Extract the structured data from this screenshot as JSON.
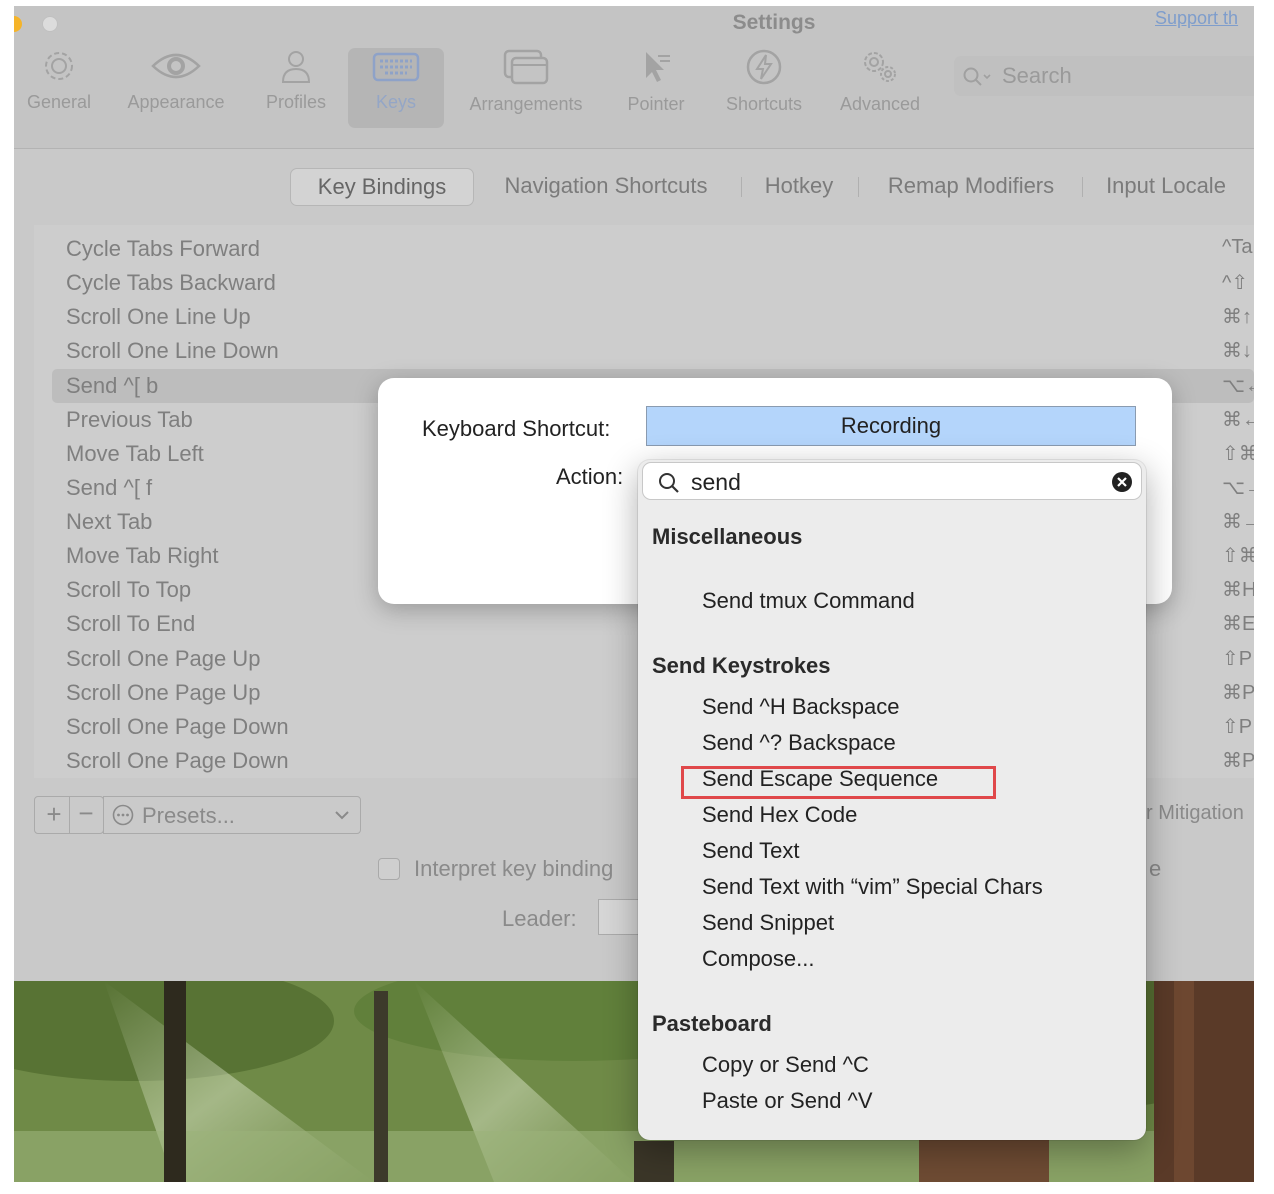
{
  "window": {
    "title": "Settings",
    "support_link": "Support th",
    "traffic_colors": {
      "yellow": "#f5b429",
      "inactive": "#dcdcdc"
    }
  },
  "toolbar": {
    "items": [
      {
        "label": "General",
        "icon": "gear-icon"
      },
      {
        "label": "Appearance",
        "icon": "eye-icon"
      },
      {
        "label": "Profiles",
        "icon": "person-icon"
      },
      {
        "label": "Keys",
        "icon": "keyboard-icon"
      },
      {
        "label": "Arrangements",
        "icon": "windows-icon"
      },
      {
        "label": "Pointer",
        "icon": "cursor-icon"
      },
      {
        "label": "Shortcuts",
        "icon": "bolt-icon"
      },
      {
        "label": "Advanced",
        "icon": "gears-icon"
      }
    ],
    "active": "Keys",
    "search_placeholder": "Search"
  },
  "tabs": [
    {
      "label": "Key Bindings",
      "selected": true
    },
    {
      "label": "Navigation Shortcuts"
    },
    {
      "label": "Hotkey"
    },
    {
      "label": "Remap Modifiers"
    },
    {
      "label": "Input Locale"
    }
  ],
  "bindings": [
    {
      "action": "Cycle Tabs Forward",
      "key": "^Ta"
    },
    {
      "action": "Cycle Tabs Backward",
      "key": "^⇧"
    },
    {
      "action": "Scroll One Line Up",
      "key": "⌘↑"
    },
    {
      "action": "Scroll One Line Down",
      "key": "⌘↓"
    },
    {
      "action": "Send ^[ b",
      "key": "⌥←",
      "selected": true
    },
    {
      "action": "Previous Tab",
      "key": "⌘←"
    },
    {
      "action": "Move Tab Left",
      "key": "⇧⌘"
    },
    {
      "action": "Send ^[ f",
      "key": "⌥→"
    },
    {
      "action": "Next Tab",
      "key": "⌘→"
    },
    {
      "action": "Move Tab Right",
      "key": "⇧⌘"
    },
    {
      "action": "Scroll To Top",
      "key": "⌘H"
    },
    {
      "action": "Scroll To End",
      "key": "⌘E"
    },
    {
      "action": "Scroll One Page Up",
      "key": "⇧P"
    },
    {
      "action": "Scroll One Page Up",
      "key": "⌘P"
    },
    {
      "action": "Scroll One Page Down",
      "key": "⇧P"
    },
    {
      "action": "Scroll One Page Down",
      "key": "⌘P"
    }
  ],
  "controls": {
    "add": "+",
    "remove": "−",
    "presets": "Presets...",
    "mitigation": "r Mitigation",
    "interpret_label": "Interpret key binding",
    "interpret_tail": "e",
    "leader_label": "Leader:"
  },
  "dialog": {
    "shortcut_label": "Keyboard Shortcut:",
    "recording": "Recording",
    "action_label": "Action:"
  },
  "popup": {
    "filter_value": "send",
    "sections": [
      {
        "title": "Miscellaneous",
        "items": [
          "Send tmux Command"
        ]
      },
      {
        "title": "Send Keystrokes",
        "items": [
          "Send ^H Backspace",
          "Send ^? Backspace",
          "Send Escape Sequence",
          "Send Hex Code",
          "Send Text",
          "Send Text with “vim” Special Chars",
          "Send Snippet",
          "Compose..."
        ]
      },
      {
        "title": "Pasteboard",
        "items": [
          "Copy or Send ^C",
          "Paste or Send ^V"
        ]
      }
    ],
    "highlighted_item": "Send Escape Sequence",
    "highlight_color": "#e0484a"
  }
}
